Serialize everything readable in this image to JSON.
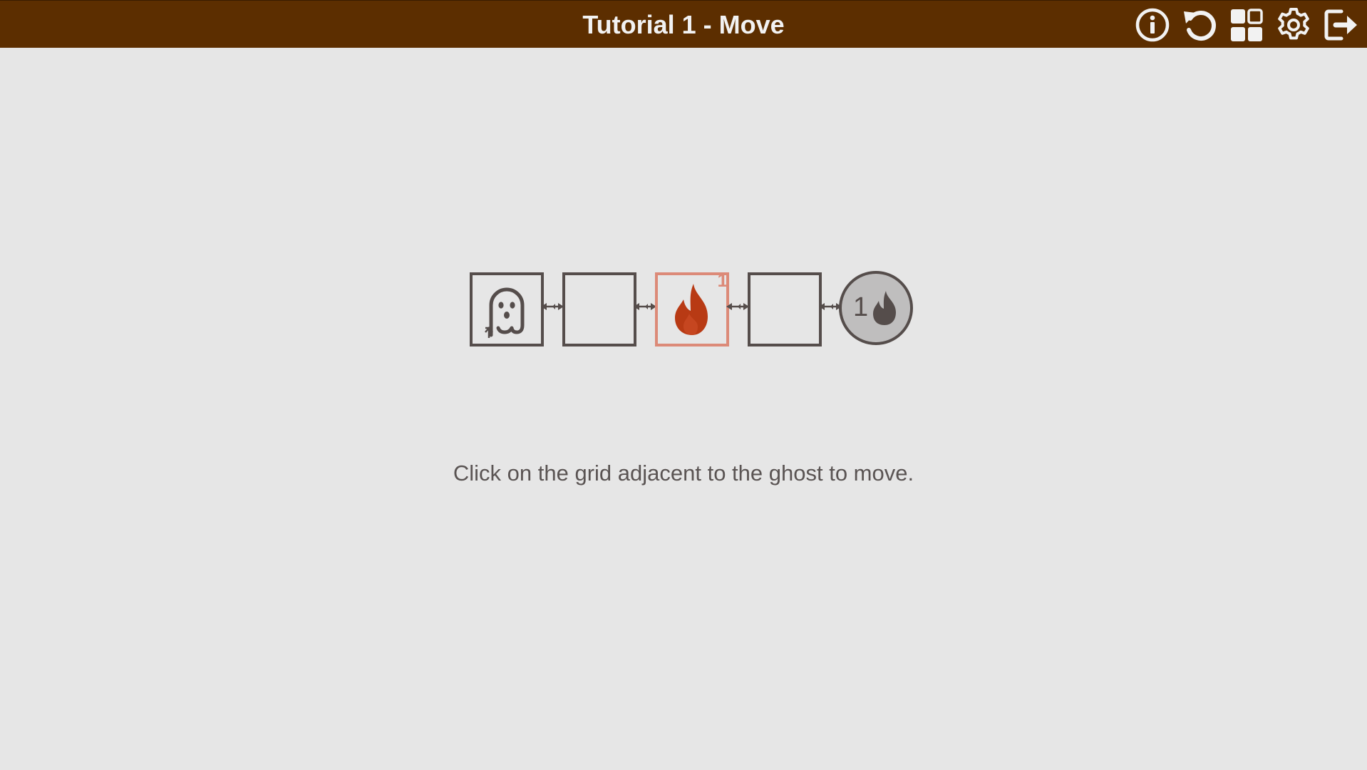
{
  "header": {
    "title": "Tutorial 1 - Move",
    "tools": [
      {
        "name": "info-icon",
        "icon": "info"
      },
      {
        "name": "restart-icon",
        "icon": "restart"
      },
      {
        "name": "level-select-icon",
        "icon": "grid"
      },
      {
        "name": "settings-icon",
        "icon": "gear"
      },
      {
        "name": "exit-icon",
        "icon": "exit"
      }
    ]
  },
  "board": {
    "cells": [
      {
        "content": "ghost",
        "icon": "ghost-icon"
      },
      {
        "content": "empty"
      },
      {
        "content": "fire",
        "icon": "fire-icon",
        "count": "1"
      },
      {
        "content": "empty"
      }
    ],
    "goal": {
      "count": "1",
      "icon": "fire-icon"
    }
  },
  "hint": "Click on the grid adjacent to the ghost to move.",
  "colors": {
    "header_bg": "#5c2e00",
    "background": "#e6e6e6",
    "cell_border": "#554d4b",
    "fire": "#b83a14",
    "fire_cell_border": "#dc8a78",
    "goal_fill": "#bfbebe"
  }
}
